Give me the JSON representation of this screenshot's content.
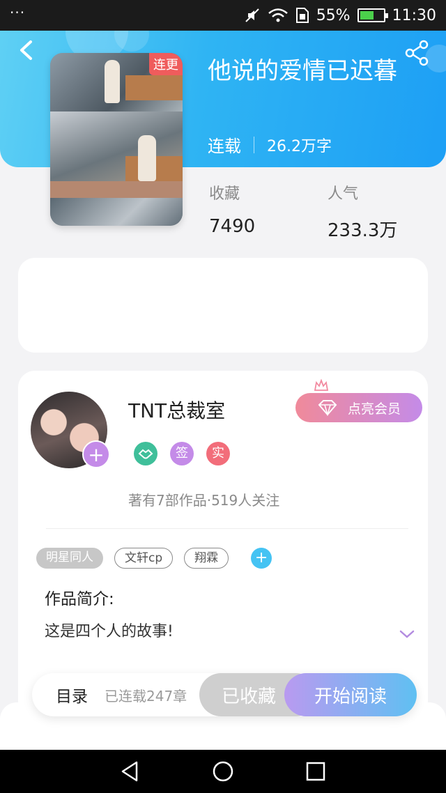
{
  "status_bar": {
    "dots": "···",
    "battery": "55%",
    "time": "11:30"
  },
  "book": {
    "title": "他说的爱情已迟暮",
    "cover_tag": "连更",
    "status": "连载",
    "word_count": "26.2万字",
    "favorites_label": "收藏",
    "favorites_value": "7490",
    "popularity_label": "人气",
    "popularity_value": "233.3万"
  },
  "author": {
    "name": "TNT总裁室",
    "vip_button": "点亮会员",
    "badge_sign": "签",
    "badge_real": "实",
    "stats": "著有7部作品·519人关注"
  },
  "tags": [
    "明星同人",
    "文轩cp",
    "翔霖"
  ],
  "intro": {
    "heading": "作品简介:",
    "text": "这是四个人的故事!"
  },
  "bottom_bar": {
    "toc_label": "目录",
    "toc_count": "已连载247章",
    "collected_label": "已收藏",
    "read_label": "开始阅读"
  },
  "colors": {
    "header_gradient_start": "#5fd0f4",
    "header_gradient_end": "#1d9ff5",
    "accent_purple": "#c48be8",
    "accent_pink": "#f08a9a",
    "tag_red": "#ef5c5c"
  }
}
